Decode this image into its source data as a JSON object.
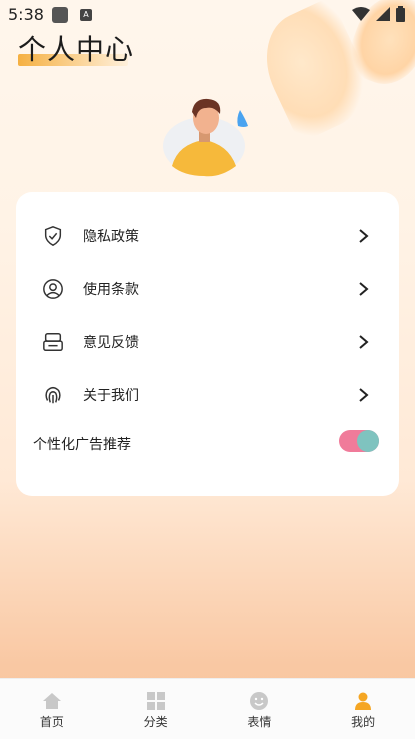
{
  "status_bar": {
    "time": "5:38",
    "notif_icon_letter": "A"
  },
  "header": {
    "title": "个人中心"
  },
  "menu": {
    "items": [
      {
        "label": "隐私政策",
        "icon": "shield-check-icon"
      },
      {
        "label": "使用条款",
        "icon": "user-circle-icon"
      },
      {
        "label": "意见反馈",
        "icon": "feedback-box-icon"
      },
      {
        "label": "关于我们",
        "icon": "fingerprint-icon"
      }
    ],
    "toggle": {
      "label": "个性化广告推荐",
      "state": "on"
    }
  },
  "bottom_nav": {
    "items": [
      {
        "label": "首页",
        "icon": "home-icon",
        "active": false
      },
      {
        "label": "分类",
        "icon": "grid-icon",
        "active": false
      },
      {
        "label": "表情",
        "icon": "smiley-icon",
        "active": false
      },
      {
        "label": "我的",
        "icon": "person-icon",
        "active": true
      }
    ]
  },
  "colors": {
    "accent": "#f5a623",
    "toggle_track": "#f07b9a",
    "toggle_knob": "#7fc3bf"
  }
}
